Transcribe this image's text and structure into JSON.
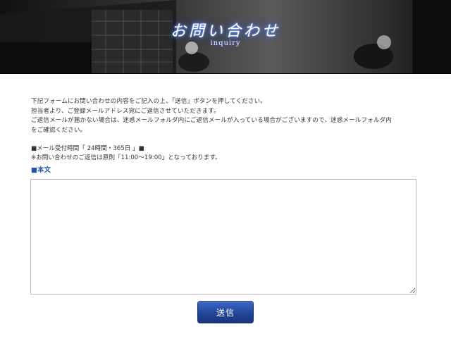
{
  "header": {
    "title": "お問い合わせ",
    "subtitle": "inquiry"
  },
  "intro": {
    "lines": [
      "下記フォームにお問い合わせの内容をご記入の上、「送信」ボタンを押してください。",
      "担当者より、ご登録メールアドレス宛にご返信させていただきます。",
      "ご返信メールが届かない場合は、迷惑メールフォルダ内にご返信メールが入っている場合がございますので、迷惑メールフォルダ内",
      "をご確認ください。"
    ]
  },
  "hours": {
    "line1": "■メール受付時間「 24時間・365日 」■",
    "line2": "※お問い合わせのご返信は原則「11:00〜19:00」となっております。"
  },
  "form": {
    "body_label": "■本文",
    "body_value": "",
    "submit_label": "送信"
  },
  "colors": {
    "accent": "#1f55a8",
    "button": "#24479c",
    "header_bg": "#2b2b2c"
  }
}
